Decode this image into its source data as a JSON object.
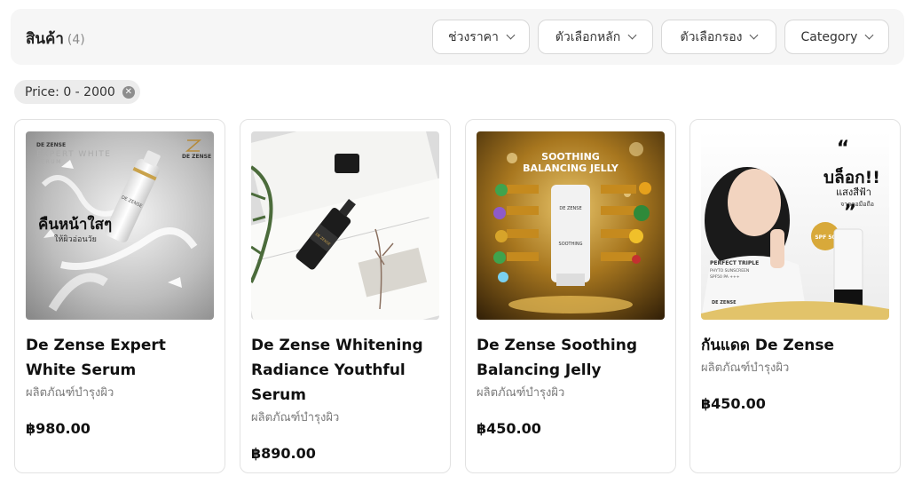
{
  "header": {
    "title": "สินค้า",
    "count": "(4)"
  },
  "filters": [
    {
      "label": "ช่วงราคา"
    },
    {
      "label": "ตัวเลือกหลัก"
    },
    {
      "label": "ตัวเลือกรอง"
    },
    {
      "label": "Category"
    }
  ],
  "active_filter": {
    "label": "Price: 0 - 2000",
    "remove_icon": "close-circle-icon"
  },
  "products": [
    {
      "name": "De Zense Expert White Serum",
      "category": "ผลิตภัณฑ์บำรุงผิว",
      "price": "฿980.00",
      "image": {
        "brand": "DE ZENSE",
        "line": "EXPERT WHITE",
        "sub": "SERUM",
        "headline": "คืนหน้าใสๆ",
        "subline": "ให้ผิวอ่อนวัย"
      }
    },
    {
      "name": "De Zense Whitening Radiance Youthful Serum",
      "category": "ผลิตภัณฑ์บำรุงผิว",
      "price": "฿890.00",
      "image": {}
    },
    {
      "name": "De Zense Soothing Balancing Jelly",
      "category": "ผลิตภัณฑ์บำรุงผิว",
      "price": "฿450.00",
      "image": {
        "title1": "SOOTHING",
        "title2": "BALANCING JELLY",
        "tube_brand": "DE ZENSE",
        "tube_label": "SOOTHING"
      }
    },
    {
      "name": "กันแดด De Zense",
      "category": "ผลิตภัณฑ์บำรุงผิว",
      "price": "฿450.00",
      "image": {
        "headline": "บล็อก!!",
        "subline": "แสงสีฟ้า",
        "subline2": "จากจอมือถือ",
        "spf": "SPF 50",
        "tag1": "PERFECT TRIPLE",
        "tag2": "PHYTO SUNSCREEN",
        "tag3": "SPF50 PA +++",
        "brand": "DE ZENSE"
      }
    }
  ]
}
